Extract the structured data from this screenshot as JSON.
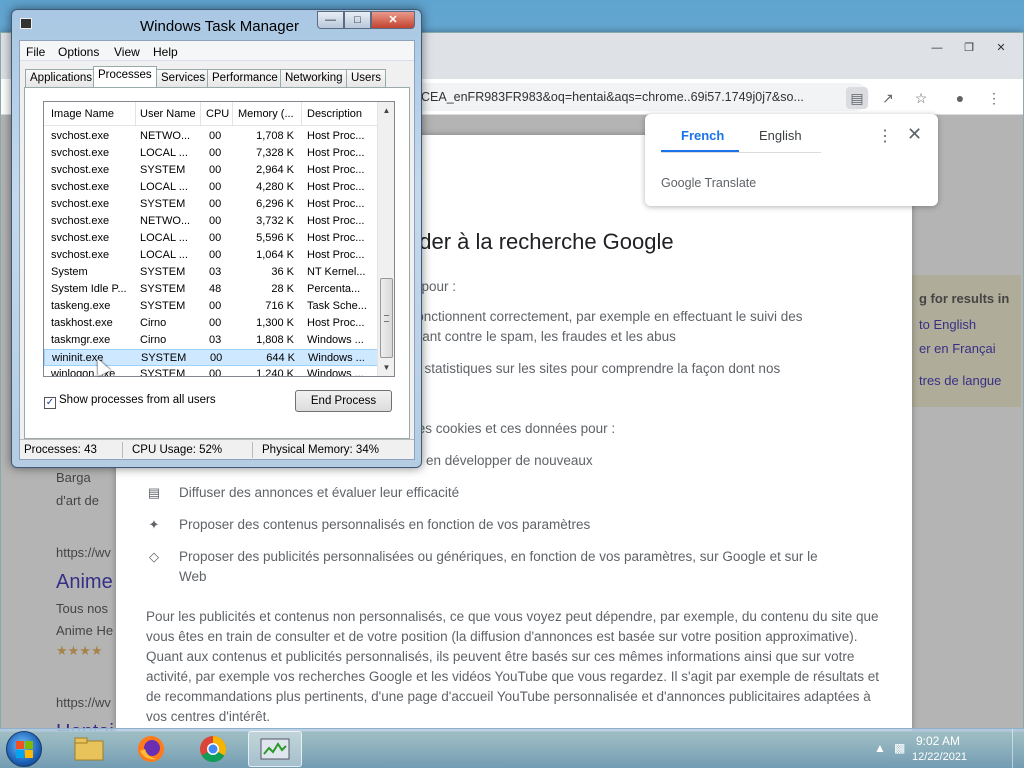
{
  "task_manager": {
    "title": "Windows Task Manager",
    "menu": [
      "File",
      "Options",
      "View",
      "Help"
    ],
    "tabs": [
      "Applications",
      "Processes",
      "Services",
      "Performance",
      "Networking",
      "Users"
    ],
    "selected_tab": "Processes",
    "columns": [
      "Image Name",
      "User Name",
      "CPU",
      "Memory (...",
      "Description"
    ],
    "rows": [
      {
        "name": "svchost.exe",
        "user": "NETWO...",
        "cpu": "00",
        "mem": "1,708 K",
        "desc": "Host Proc..."
      },
      {
        "name": "svchost.exe",
        "user": "LOCAL ...",
        "cpu": "00",
        "mem": "7,328 K",
        "desc": "Host Proc..."
      },
      {
        "name": "svchost.exe",
        "user": "SYSTEM",
        "cpu": "00",
        "mem": "2,964 K",
        "desc": "Host Proc..."
      },
      {
        "name": "svchost.exe",
        "user": "LOCAL ...",
        "cpu": "00",
        "mem": "4,280 K",
        "desc": "Host Proc..."
      },
      {
        "name": "svchost.exe",
        "user": "SYSTEM",
        "cpu": "00",
        "mem": "6,296 K",
        "desc": "Host Proc..."
      },
      {
        "name": "svchost.exe",
        "user": "NETWO...",
        "cpu": "00",
        "mem": "3,732 K",
        "desc": "Host Proc..."
      },
      {
        "name": "svchost.exe",
        "user": "LOCAL ...",
        "cpu": "00",
        "mem": "5,596 K",
        "desc": "Host Proc..."
      },
      {
        "name": "svchost.exe",
        "user": "LOCAL ...",
        "cpu": "00",
        "mem": "1,064 K",
        "desc": "Host Proc..."
      },
      {
        "name": "System",
        "user": "SYSTEM",
        "cpu": "03",
        "mem": "36 K",
        "desc": "NT Kernel..."
      },
      {
        "name": "System Idle P...",
        "user": "SYSTEM",
        "cpu": "48",
        "mem": "28 K",
        "desc": "Percenta..."
      },
      {
        "name": "taskeng.exe",
        "user": "SYSTEM",
        "cpu": "00",
        "mem": "716 K",
        "desc": "Task Sche..."
      },
      {
        "name": "taskhost.exe",
        "user": "Cirno",
        "cpu": "00",
        "mem": "1,300 K",
        "desc": "Host Proc..."
      },
      {
        "name": "taskmgr.exe",
        "user": "Cirno",
        "cpu": "03",
        "mem": "1,808 K",
        "desc": "Windows ..."
      },
      {
        "name": "wininit.exe",
        "user": "SYSTEM",
        "cpu": "00",
        "mem": "644 K",
        "desc": "Windows ...",
        "selected": true
      },
      {
        "name": "winlogon.exe",
        "user": "SYSTEM",
        "cpu": "00",
        "mem": "1,240 K",
        "desc": "Windows ..."
      }
    ],
    "show_all_label": "Show processes from all users",
    "show_all_checked": true,
    "end_process_label": "End Process",
    "status": {
      "processes": "Processes: 43",
      "cpu": "CPU Usage: 52%",
      "memory": "Physical Memory: 34%"
    }
  },
  "chrome": {
    "url": "CEA_enFR983FR983&oq=hentai&aqs=chrome..69i57.1749j0j7&so...",
    "translate": {
      "tab_source": "French",
      "tab_target": "English",
      "footer": "Google Translate",
      "menu_icon": "more-vert-icon",
      "close_icon": "close-icon"
    },
    "consent": {
      "heading": "céder à la recherche Google",
      "lines": [
        "ées pour :",
        "ils fonctionnent correctement, par exemple en effectuant le suivi des",
        "tégeant contre le spam, les fraudes et les abus",
        "t les statistiques sur les sites pour comprendre la façon dont nos",
        "nt ces cookies et ces données pour :",
        "en développer de nouveaux",
        "Diffuser des annonces et évaluer leur efficacité",
        "Proposer des contenus personnalisés en fonction de vos paramètres",
        "Proposer des publicités personnalisées ou génériques, en fonction de vos paramètres, sur Google et sur le",
        "Web"
      ],
      "paragraph": "Pour les publicités et contenus non personnalisés, ce que vous voyez peut dépendre, par exemple, du contenu du site que vous êtes en train de consulter et de votre position (la diffusion d'annonces est basée sur votre position approximative). Quant aux contenus et publicités personnalisés, ils peuvent être basés sur ces mêmes informations ainsi que sur votre activité, par exemple vos recherches Google et les vidéos YouTube que vous regardez. Il s'agit par exemple de résultats et de recommandations plus pertinents, d'une page d'accueil YouTube personnalisée et d'annonces publicitaires adaptées à vos centres d'intérêt."
    },
    "serp": {
      "left_snippets": [
        "Barga",
        "d'art de",
        "https://wv",
        "Anime",
        "Tous nos",
        "Anime He",
        "★★★★",
        "https://wv",
        "Hentai"
      ],
      "right_panel": [
        "g for results in",
        "to English",
        "er en Françai",
        "tres de langue"
      ]
    }
  },
  "taskbar": {
    "time": "9:02 AM",
    "date": "12/22/2021",
    "apps": [
      "explorer-folder-icon",
      "firefox-icon",
      "chrome-icon",
      "task-manager-icon"
    ]
  }
}
